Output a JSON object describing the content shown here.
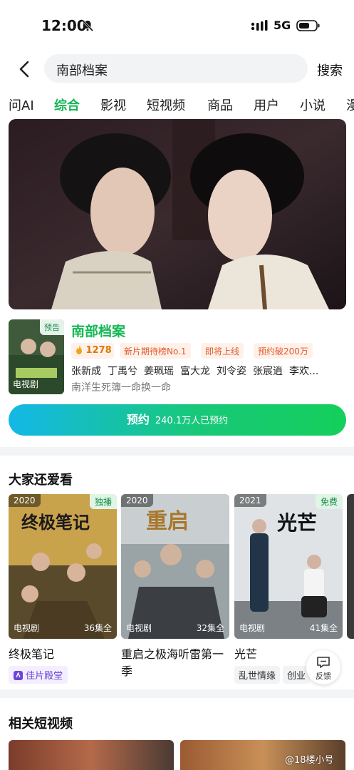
{
  "status": {
    "time": "12:00",
    "network": "5G"
  },
  "search": {
    "query": "南部档案",
    "button": "搜索"
  },
  "tabs": [
    "问AI",
    "综合",
    "影视",
    "短视频",
    "商品",
    "用户",
    "小说",
    "漫"
  ],
  "active_tab": "综合",
  "show": {
    "poster_badge": "预告",
    "poster_type": "电视剧",
    "title": "南部档案",
    "heat": "1278",
    "chips": [
      "新片期待榜No.1",
      "即将上线",
      "预约破200万"
    ],
    "cast": [
      "张新成",
      "丁禹兮",
      "姜珮瑶",
      "富大龙",
      "刘令姿",
      "张宸逍",
      "李欢..."
    ],
    "tagline": "南洋生死簿一命换一命",
    "reserve_label": "预约",
    "reserve_count": "240.1万人已预约"
  },
  "recommend": {
    "title": "大家还爱看",
    "cards": [
      {
        "year": "2020",
        "badge": "独播",
        "kind": "电视剧",
        "eps": "36集全",
        "name": "终极笔记",
        "brand": "佳片殿堂",
        "poster_text": "终极笔记"
      },
      {
        "year": "2020",
        "badge": "",
        "kind": "电视剧",
        "eps": "32集全",
        "name": "重启之极海听雷第一季",
        "poster_text": "重启"
      },
      {
        "year": "2021",
        "badge": "免费",
        "kind": "电视剧",
        "eps": "41集全",
        "name": "光芒",
        "tags": [
          "乱世情缘",
          "创业"
        ],
        "poster_text": "光芒"
      }
    ]
  },
  "feedback": "反馈",
  "short_videos": {
    "title": "相关短视频"
  },
  "watermark": "@18楼小号",
  "colors": {
    "accent": "#15b854",
    "chip_text": "#e05a2b",
    "chip_bg": "#fff1ea"
  }
}
